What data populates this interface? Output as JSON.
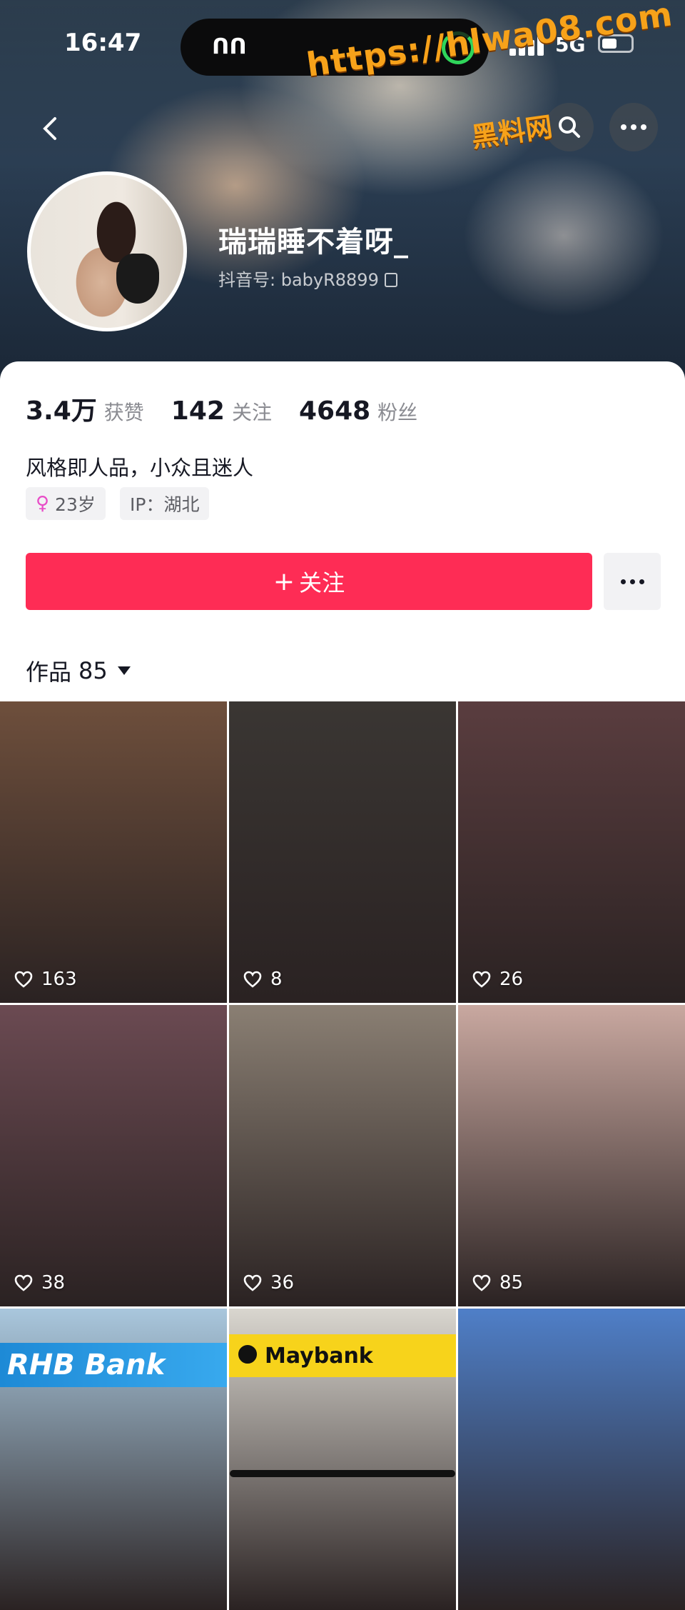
{
  "status_bar": {
    "time": "16:47",
    "network": "5G"
  },
  "watermark": {
    "url": "https://hlwa08.com",
    "site": "黑料网"
  },
  "profile": {
    "nickname": "瑞瑞睡不着呀_",
    "douyin_id": "抖音号: babyR8899",
    "stats": [
      {
        "value": "3.4万",
        "label": "获赞"
      },
      {
        "value": "142",
        "label": "关注"
      },
      {
        "value": "4648",
        "label": "粉丝"
      }
    ],
    "bio": "风格即人品，小众且迷人",
    "tags": {
      "age": "23岁",
      "ip": "IP：湖北"
    },
    "follow_label": "关注"
  },
  "works": {
    "label": "作品",
    "count": "85"
  },
  "grid": [
    {
      "likes": "163",
      "bg": "#6e4f3c"
    },
    {
      "likes": "8",
      "bg": "#3a3633"
    },
    {
      "likes": "26",
      "bg": "#5a3d3f"
    },
    {
      "likes": "38",
      "bg": "#6b4a52"
    },
    {
      "likes": "36",
      "bg": "#8a7f73"
    },
    {
      "likes": "85",
      "bg": "#c9a8a0"
    },
    {
      "likes": "",
      "bg": "#a9c7dd",
      "sign": "RHB Bank"
    },
    {
      "likes": "",
      "bg": "#d9d6cf",
      "sign": "Maybank"
    },
    {
      "likes": "",
      "bg": "#4f7fc8"
    }
  ],
  "colors": {
    "accent": "#fe2c55",
    "female": "#e84cc7"
  }
}
